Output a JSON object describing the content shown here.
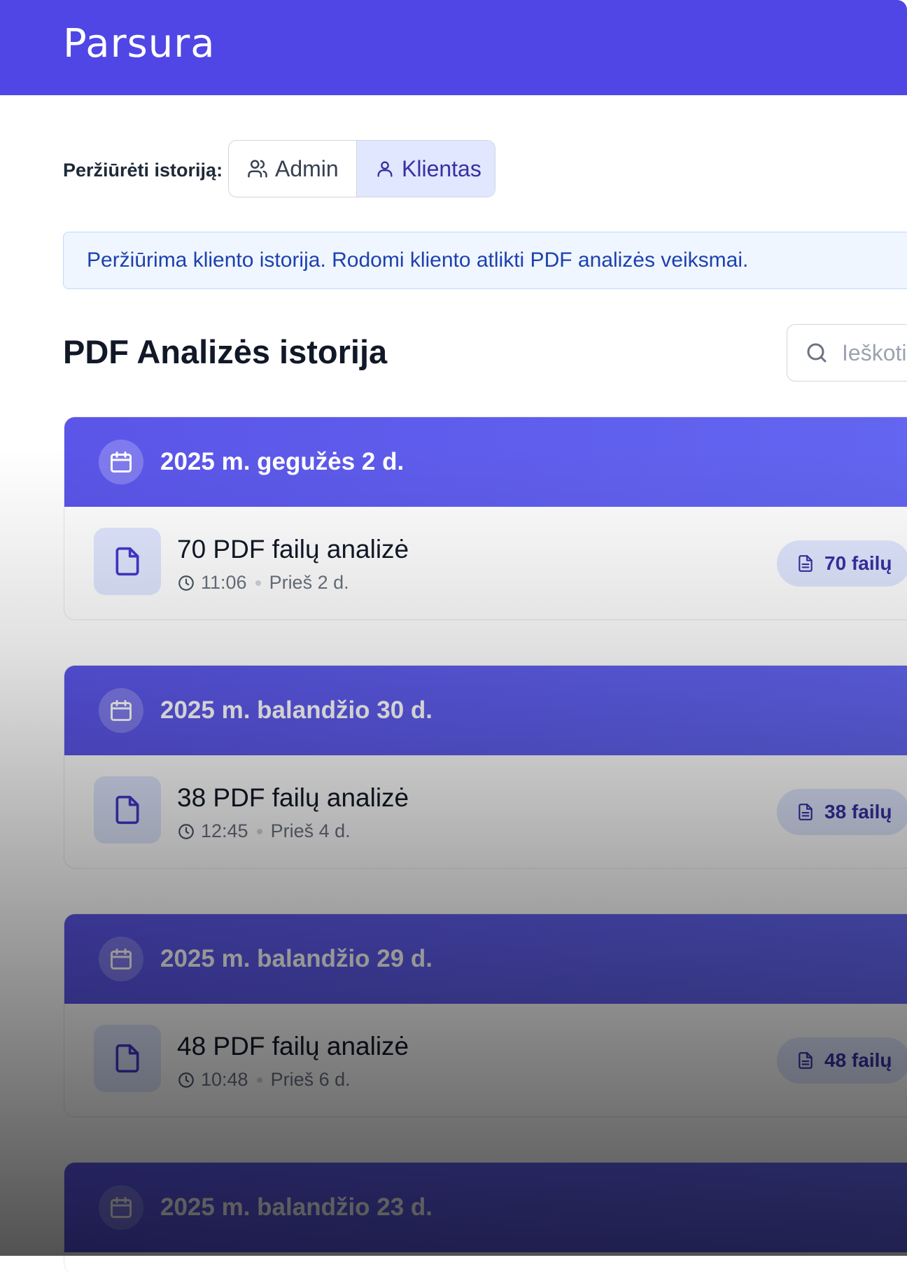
{
  "app": {
    "title": "Parsura"
  },
  "view_switch": {
    "label": "Peržiūrėti istoriją:",
    "options": [
      {
        "label": "Admin",
        "icon": "users-icon",
        "selected": false
      },
      {
        "label": "Klientas",
        "icon": "user-icon",
        "selected": true
      }
    ]
  },
  "info_banner": {
    "text": "Peržiūrima kliento istorija. Rodomi kliento atlikti PDF analizės veiksmai."
  },
  "history": {
    "title": "PDF Analizės istorija",
    "search_placeholder": "Ieškoti",
    "groups": [
      {
        "date": "2025 m. gegužės 2 d.",
        "item": {
          "title": "70 PDF failų analizė",
          "time": "11:06",
          "relative": "Prieš 2 d.",
          "badge": "70 failų"
        }
      },
      {
        "date": "2025 m. balandžio 30 d.",
        "item": {
          "title": "38 PDF failų analizė",
          "time": "12:45",
          "relative": "Prieš 4 d.",
          "badge": "38 failų"
        }
      },
      {
        "date": "2025 m. balandžio 29 d.",
        "item": {
          "title": "48 PDF failų analizė",
          "time": "10:48",
          "relative": "Prieš 6 d.",
          "badge": "48 failų"
        }
      },
      {
        "date": "2025 m. balandžio 23 d."
      }
    ]
  },
  "colors": {
    "primary": "#4f46e5",
    "accent_light": "#e0e7ff",
    "info_bg": "#eff6ff",
    "info_text": "#1e40af"
  }
}
